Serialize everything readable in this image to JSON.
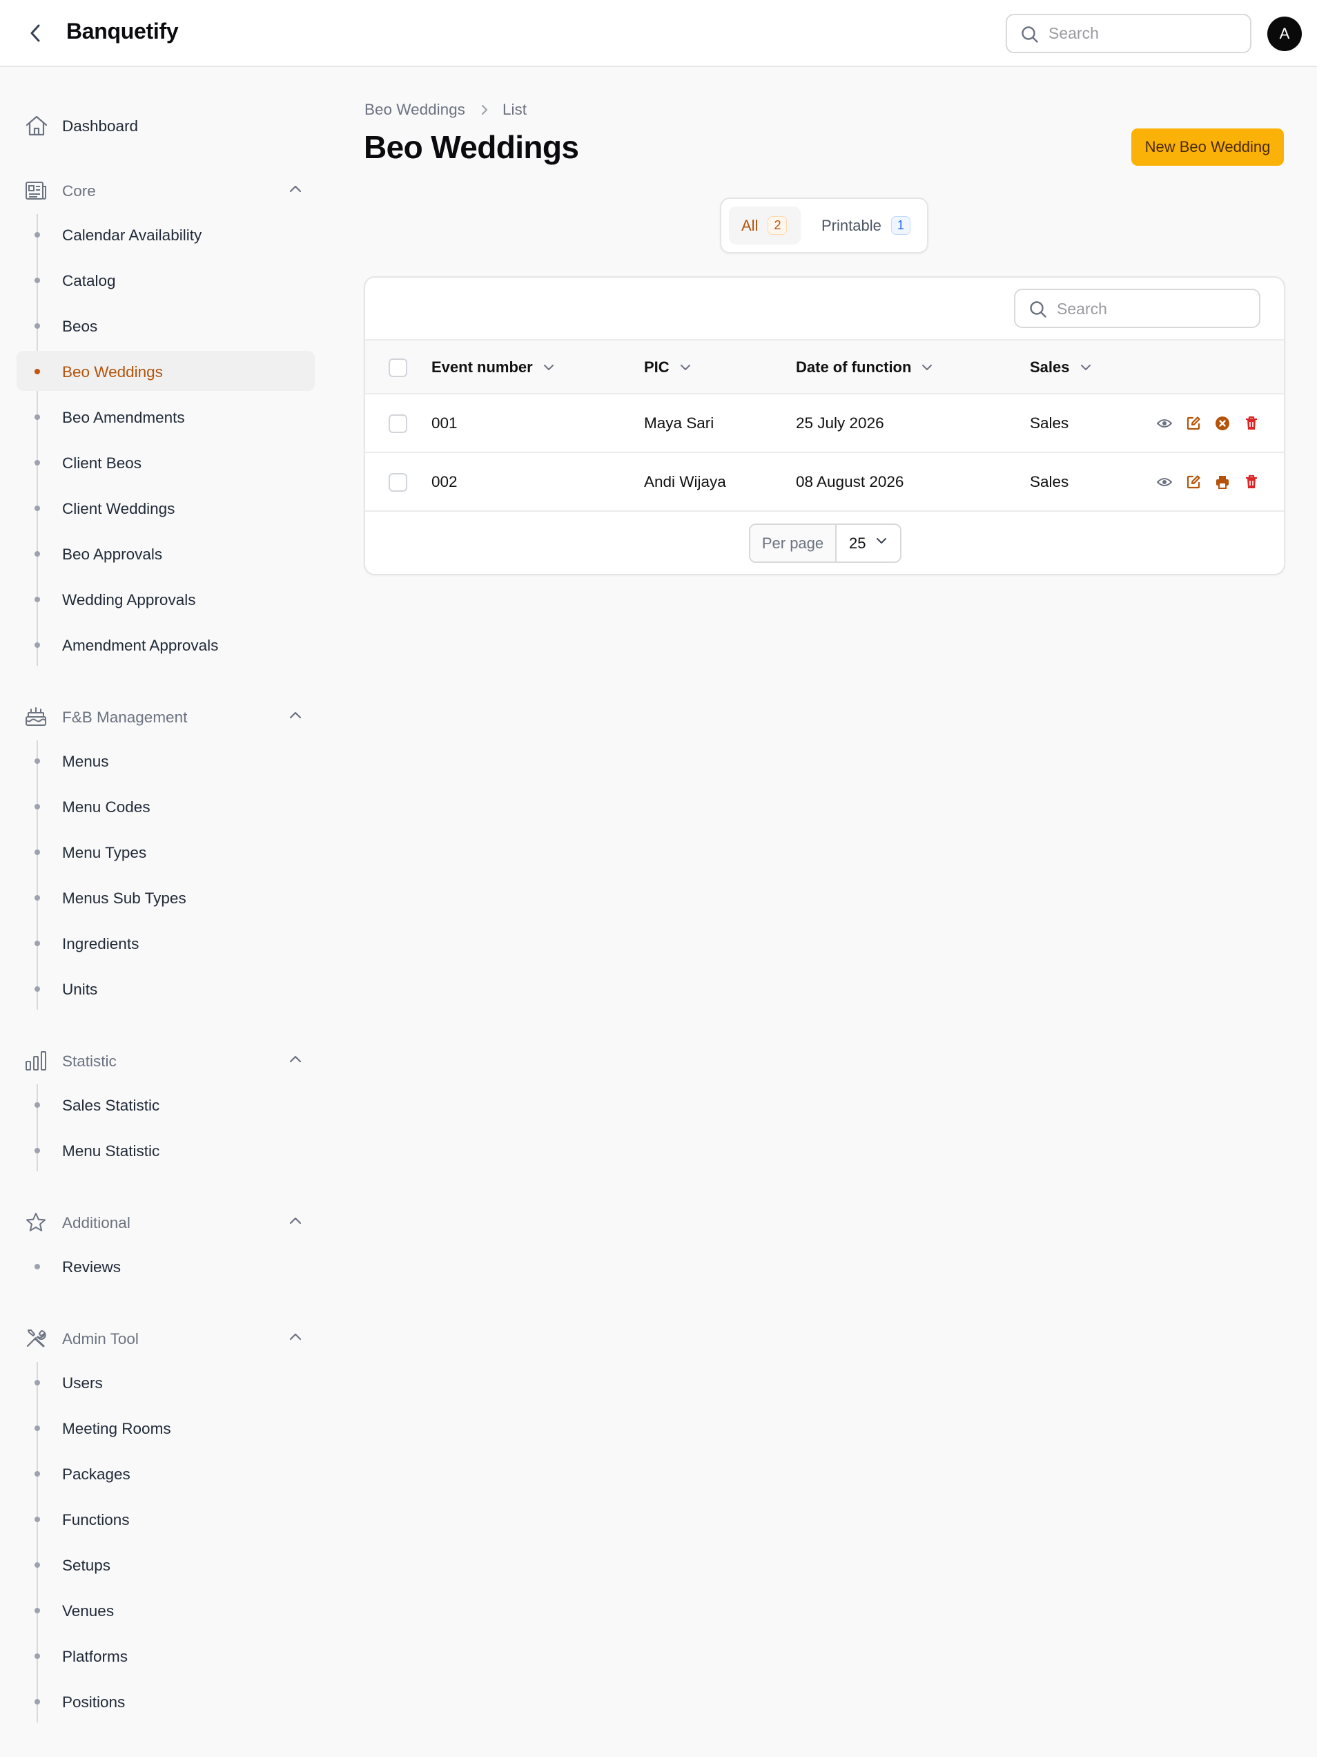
{
  "app": {
    "title": "Banquetify",
    "search_placeholder": "Search",
    "avatar_initial": "A"
  },
  "sidebar": {
    "dashboard": "Dashboard",
    "groups": [
      {
        "label": "Core",
        "icon": "newspaper-icon",
        "items": [
          "Calendar Availability",
          "Catalog",
          "Beos",
          "Beo Weddings",
          "Beo Amendments",
          "Client Beos",
          "Client Weddings",
          "Beo Approvals",
          "Wedding Approvals",
          "Amendment Approvals"
        ],
        "active": "Beo Weddings"
      },
      {
        "label": "F&B Management",
        "icon": "cake-icon",
        "items": [
          "Menus",
          "Menu Codes",
          "Menu Types",
          "Menus Sub Types",
          "Ingredients",
          "Units"
        ]
      },
      {
        "label": "Statistic",
        "icon": "bar-chart-icon",
        "items": [
          "Sales Statistic",
          "Menu Statistic"
        ]
      },
      {
        "label": "Additional",
        "icon": "star-icon",
        "items": [
          "Reviews"
        ]
      },
      {
        "label": "Admin Tool",
        "icon": "wrench-screwdriver-icon",
        "items": [
          "Users",
          "Meeting Rooms",
          "Packages",
          "Functions",
          "Setups",
          "Venues",
          "Platforms",
          "Positions"
        ]
      }
    ]
  },
  "breadcrumb": {
    "parent": "Beo Weddings",
    "current": "List"
  },
  "page": {
    "title": "Beo Weddings",
    "new_button": "New Beo Wedding"
  },
  "tabs": [
    {
      "label": "All",
      "count": "2",
      "active": true
    },
    {
      "label": "Printable",
      "count": "1",
      "active": false
    }
  ],
  "table": {
    "search_placeholder": "Search",
    "columns": [
      "Event number",
      "PIC",
      "Date of function",
      "Sales"
    ],
    "rows": [
      {
        "event_number": "001",
        "pic": "Maya Sari",
        "date": "25 July 2026",
        "sales": "Sales",
        "actions": [
          "view-icon",
          "edit-icon",
          "cancel-circle-icon",
          "trash-icon"
        ]
      },
      {
        "event_number": "002",
        "pic": "Andi Wijaya",
        "date": "08 August 2026",
        "sales": "Sales",
        "actions": [
          "view-icon",
          "edit-icon",
          "print-icon",
          "trash-icon"
        ]
      }
    ],
    "pagination": {
      "per_page_label": "Per page",
      "per_page_value": "25"
    }
  },
  "colors": {
    "accent": "#b45309",
    "primary_button": "#fbb208",
    "danger": "#dc2626",
    "muted": "#6b7280"
  }
}
